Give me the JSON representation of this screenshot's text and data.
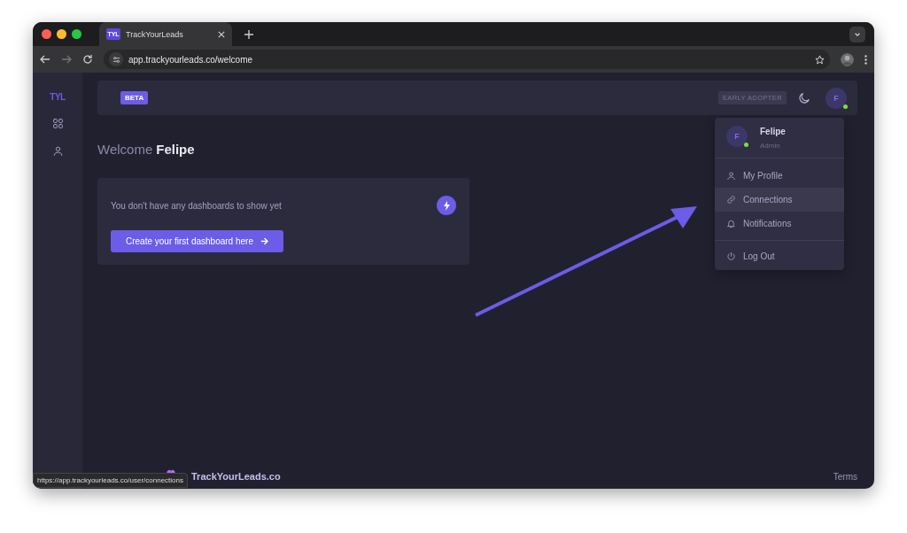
{
  "browser": {
    "tab_title": "TrackYourLeads",
    "tab_logo": "TYL",
    "url": "app.trackyourleads.co/welcome",
    "status_url": "https://app.trackyourleads.co/user/connections"
  },
  "sidebar": {
    "logo": "TYL",
    "items": [
      {
        "kind": "grid",
        "selected": false
      },
      {
        "kind": "user",
        "selected": false
      }
    ]
  },
  "header": {
    "beta_badge": "BETA",
    "early_adopter_badge": "EARLY ADOPTER",
    "avatar_initial": "F",
    "online": true
  },
  "welcome": {
    "greeting": "Welcome",
    "name": "Felipe"
  },
  "card": {
    "message": "You don't have any dashboards to show yet",
    "button": "Create your first dashboard here"
  },
  "user_menu": {
    "avatar_initial": "F",
    "online": true,
    "name": "Felipe",
    "role": "Admin",
    "sections": [
      {
        "items": [
          {
            "kind": "user",
            "label": "My Profile",
            "selected": false
          },
          {
            "kind": "link",
            "label": "Connections",
            "selected": true
          },
          {
            "kind": "bell",
            "label": "Notifications",
            "selected": false
          }
        ]
      },
      {
        "items": [
          {
            "kind": "power",
            "label": "Log Out",
            "selected": false
          }
        ]
      }
    ]
  },
  "footer": {
    "brand": "TrackYourLeads.co",
    "terms": "Terms"
  }
}
